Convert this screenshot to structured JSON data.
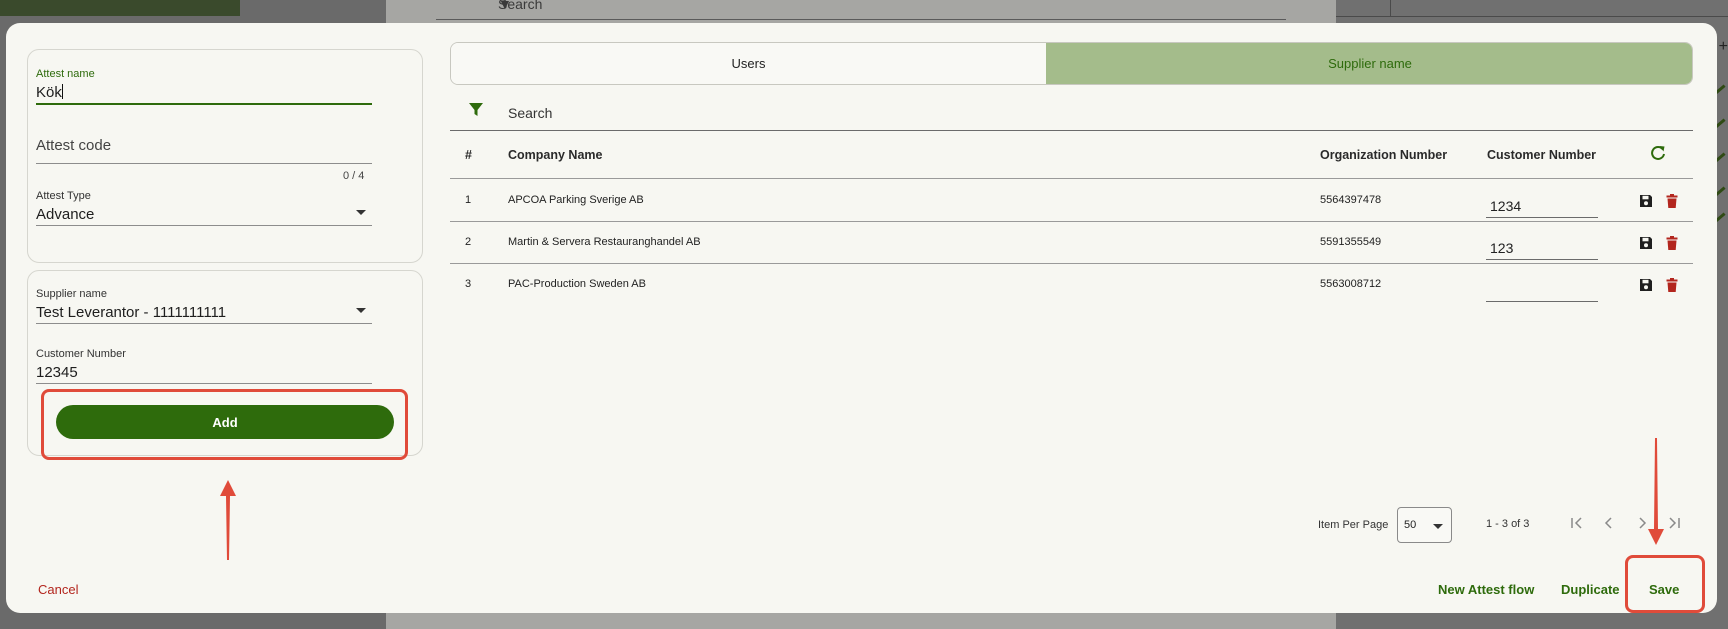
{
  "background": {
    "search_label": "Search"
  },
  "left": {
    "attest_name": {
      "label": "Attest name",
      "value": "Kök"
    },
    "attest_code": {
      "placeholder": "Attest code",
      "counter": "0 / 4"
    },
    "attest_type": {
      "label": "Attest Type",
      "value": "Advance"
    },
    "supplier": {
      "label": "Supplier name",
      "value": "Test Leverantor - 1111111111"
    },
    "customer_number": {
      "label": "Customer Number",
      "value": "12345"
    },
    "add_label": "Add"
  },
  "tabs": [
    {
      "label": "Users",
      "active": false
    },
    {
      "label": "Supplier name",
      "active": true
    }
  ],
  "search": {
    "label": "Search"
  },
  "table": {
    "headers": {
      "num": "#",
      "company": "Company Name",
      "org": "Organization Number",
      "customer": "Customer Number"
    },
    "rows": [
      {
        "num": "1",
        "company": "APCOA Parking Sverige AB",
        "org": "5564397478",
        "customer": "1234"
      },
      {
        "num": "2",
        "company": "Martin & Servera Restauranghandel AB",
        "org": "5591355549",
        "customer": "123"
      },
      {
        "num": "3",
        "company": "PAC-Production Sweden AB",
        "org": "5563008712",
        "customer": ""
      }
    ]
  },
  "pagination": {
    "items_per_page_label": "Item Per Page",
    "items_per_page": "50",
    "range": "1 - 3 of 3"
  },
  "footer": {
    "cancel": "Cancel",
    "new_flow": "New Attest flow",
    "duplicate": "Duplicate",
    "save": "Save"
  },
  "colors": {
    "accent": "#2e6b0c",
    "tab_active": "#a4bc8b",
    "danger": "#b3261e",
    "annotation": "#e04b3a"
  }
}
